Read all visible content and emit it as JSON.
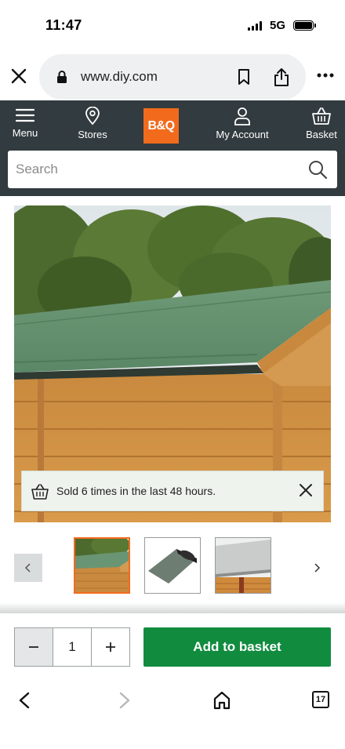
{
  "status_bar": {
    "time": "11:47",
    "network": "5G"
  },
  "browser": {
    "url": "www.diy.com",
    "tab_count": "17",
    "icons": [
      "close-icon",
      "lock-icon",
      "bookmark-icon",
      "share-icon",
      "more-icon",
      "back-icon",
      "forward-icon",
      "home-icon"
    ]
  },
  "header": {
    "logo": "B&Q",
    "nav": {
      "menu": "Menu",
      "stores": "Stores",
      "account": "My Account",
      "basket": "Basket"
    },
    "search_placeholder": "Search"
  },
  "product": {
    "sold_notice": "Sold 6 times in the last 48 hours.",
    "quantity": "1",
    "add_to_basket": "Add to basket",
    "thumbnails_visible": 3,
    "selected_thumbnail": 1
  },
  "colors": {
    "header_bg": "#323b3f",
    "brand_orange": "#f26b1d",
    "add_button_green": "#118c3f"
  }
}
